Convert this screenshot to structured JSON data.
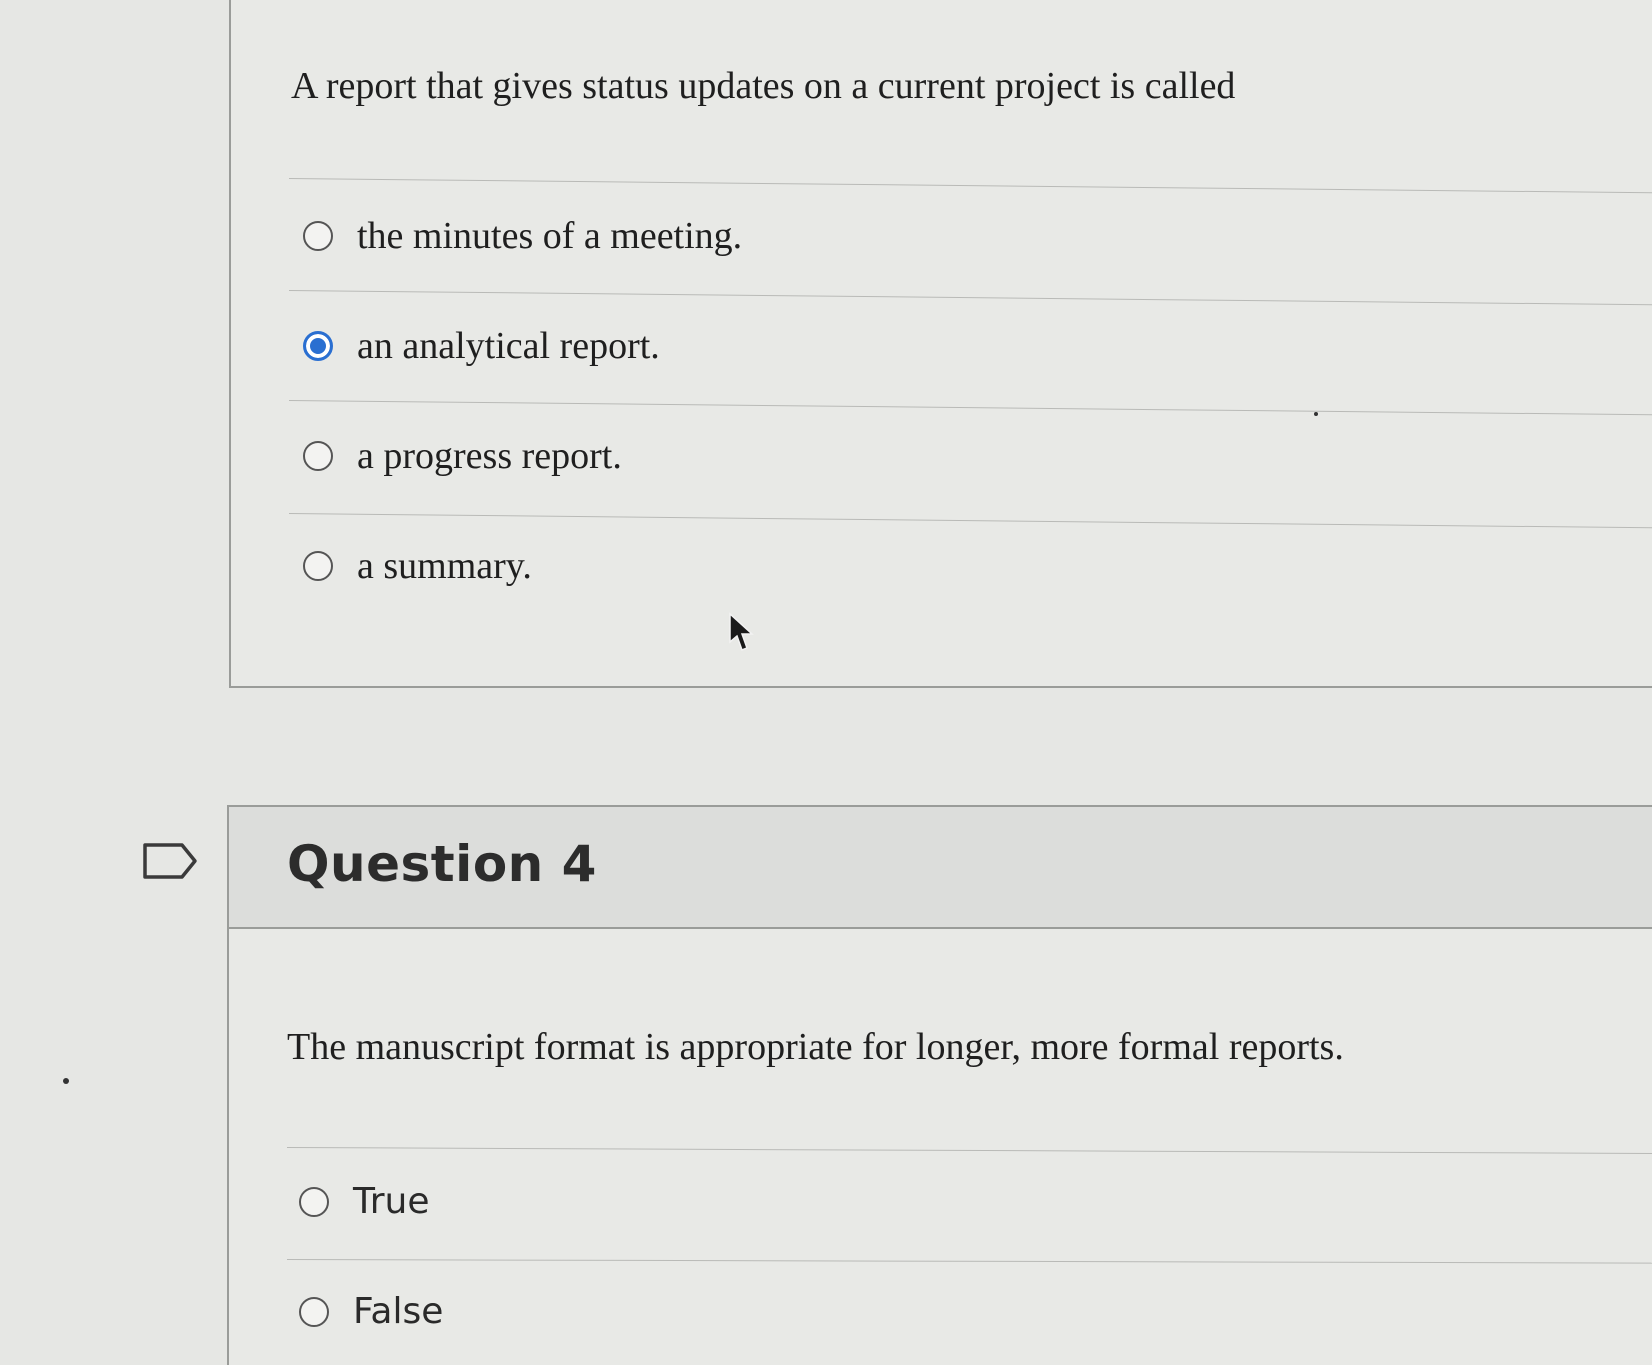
{
  "question3": {
    "text": "A report that gives status updates on a current project is called",
    "answers": [
      {
        "label": "the minutes of a meeting.",
        "selected": false
      },
      {
        "label": "an analytical report.",
        "selected": true
      },
      {
        "label": "a progress report.",
        "selected": false
      },
      {
        "label": "a summary.",
        "selected": false
      }
    ]
  },
  "question4": {
    "title": "Question 4",
    "text": "The manuscript format is appropriate for longer, more formal reports.",
    "answers": [
      {
        "label": "True",
        "selected": false
      },
      {
        "label": "False",
        "selected": false
      }
    ]
  },
  "colors": {
    "selected_radio": "#2a6fd1",
    "background": "#e6e7e4"
  },
  "icons": {
    "flag": "flag-icon",
    "cursor": "mouse-pointer-icon"
  }
}
